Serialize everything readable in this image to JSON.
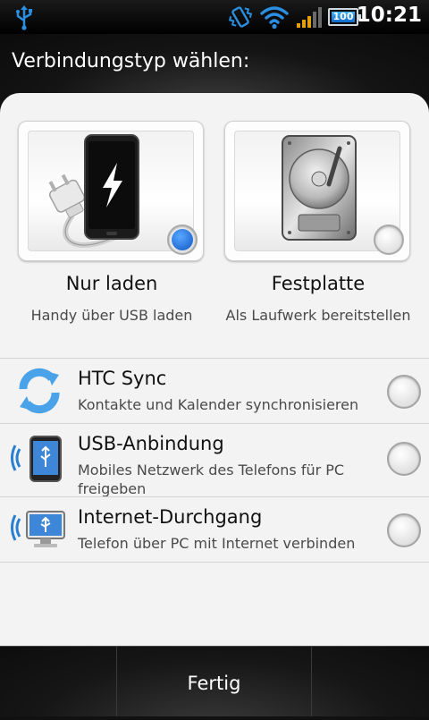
{
  "status_bar": {
    "time": "10:21",
    "battery_level": "100",
    "icons": [
      "usb-icon",
      "vibrate-icon",
      "wifi-icon",
      "signal-icon",
      "battery-icon"
    ]
  },
  "dialog": {
    "title": "Verbindungstyp wählen:",
    "options_top": [
      {
        "title": "Nur laden",
        "description": "Handy über USB laden",
        "icon": "charger-phone-icon",
        "selected": true
      },
      {
        "title": "Festplatte",
        "description": "Als Laufwerk bereitstellen",
        "icon": "hard-disk-icon",
        "selected": false
      }
    ],
    "options_list": [
      {
        "title": "HTC Sync",
        "description": "Kontakte und Kalender synchronisieren",
        "icon": "sync-icon",
        "selected": false
      },
      {
        "title": "USB-Anbindung",
        "description": "Mobiles Netzwerk des Telefons für PC freigeben",
        "icon": "usb-tether-icon",
        "selected": false
      },
      {
        "title": "Internet-Durchgang",
        "description": "Telefon über PC mit Internet verbinden",
        "icon": "internet-passthrough-icon",
        "selected": false
      }
    ],
    "done_label": "Fertig"
  },
  "colors": {
    "accent_blue": "#1f6fd6",
    "panel_bg": "#f3f3f3",
    "status_bar_bg": "#000000"
  }
}
